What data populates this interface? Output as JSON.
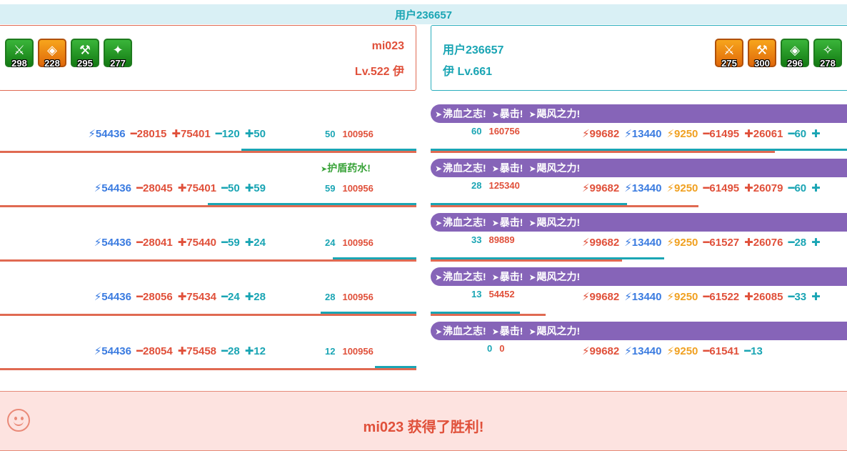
{
  "header": {
    "title": "用户236657"
  },
  "left_player": {
    "name": "mi023",
    "level": "Lv.522 伊",
    "skills": [
      {
        "icon": "sword-icon",
        "level": "298",
        "color": "green"
      },
      {
        "icon": "shield-icon",
        "level": "228",
        "color": "orange"
      },
      {
        "icon": "hammer-icon",
        "level": "295",
        "color": "green"
      },
      {
        "icon": "axe-icon",
        "level": "277",
        "color": "green"
      }
    ]
  },
  "right_player": {
    "name": "用户236657",
    "level": "伊 Lv.661",
    "skills": [
      {
        "icon": "sword-icon",
        "level": "275",
        "color": "orange"
      },
      {
        "icon": "hammer-icon",
        "level": "300",
        "color": "orange"
      },
      {
        "icon": "shield-icon",
        "level": "296",
        "color": "green"
      },
      {
        "icon": "blade-icon",
        "level": "278",
        "color": "green"
      }
    ]
  },
  "buff_labels": [
    "沸血之志!",
    "暴击!",
    "飓风之力!"
  ],
  "potion_label": "护盾药水!",
  "rounds": [
    {
      "left_stats": [
        "54436",
        "28015",
        "75401",
        "120",
        "50"
      ],
      "left_hp": {
        "current": "50",
        "max": "100956"
      },
      "left_hp_fraction": 0.42,
      "right_hp": {
        "current": "60",
        "max": "160756"
      },
      "right_hp_fraction": 0.18,
      "right_stats": [
        "99682",
        "13440",
        "9250",
        "61495",
        "26061",
        "60",
        ""
      ],
      "potion": false
    },
    {
      "left_stats": [
        "54436",
        "28045",
        "75401",
        "50",
        "59"
      ],
      "left_hp": {
        "current": "59",
        "max": "100956"
      },
      "left_hp_fraction": 0.5,
      "right_hp": {
        "current": "28",
        "max": "125340"
      },
      "right_hp_fraction": 0.46,
      "right_stats": [
        "99682",
        "13440",
        "9250",
        "61495",
        "26079",
        "60",
        ""
      ],
      "potion": true
    },
    {
      "left_stats": [
        "54436",
        "28041",
        "75440",
        "59",
        "24"
      ],
      "left_hp": {
        "current": "24",
        "max": "100956"
      },
      "left_hp_fraction": 0.2,
      "right_hp": {
        "current": "33",
        "max": "89889"
      },
      "right_hp_fraction": 0.55,
      "right_stats": [
        "99682",
        "13440",
        "9250",
        "61527",
        "26076",
        "28",
        ""
      ],
      "potion": false
    },
    {
      "left_stats": [
        "54436",
        "28056",
        "75434",
        "24",
        "28"
      ],
      "left_hp": {
        "current": "28",
        "max": "100956"
      },
      "left_hp_fraction": 0.23,
      "right_hp": {
        "current": "13",
        "max": "54452"
      },
      "right_hp_fraction": 0.21,
      "right_stats": [
        "99682",
        "13440",
        "9250",
        "61522",
        "26085",
        "33",
        ""
      ],
      "potion": false
    },
    {
      "left_stats": [
        "54436",
        "28054",
        "75458",
        "28",
        "12"
      ],
      "left_hp": {
        "current": "12",
        "max": "100956"
      },
      "left_hp_fraction": 0.1,
      "right_hp": {
        "current": "0",
        "max": "0"
      },
      "right_hp_fraction": 0,
      "right_stats": [
        "99682",
        "13440",
        "9250",
        "61541",
        "13"
      ],
      "potion": false
    }
  ],
  "result": {
    "text": "mi023 获得了胜利!"
  },
  "colors": {
    "red": "#e0503a",
    "teal": "#1aa5b4",
    "purple": "#8664b8",
    "blue": "#3a7be0",
    "orange": "#f0a020"
  }
}
